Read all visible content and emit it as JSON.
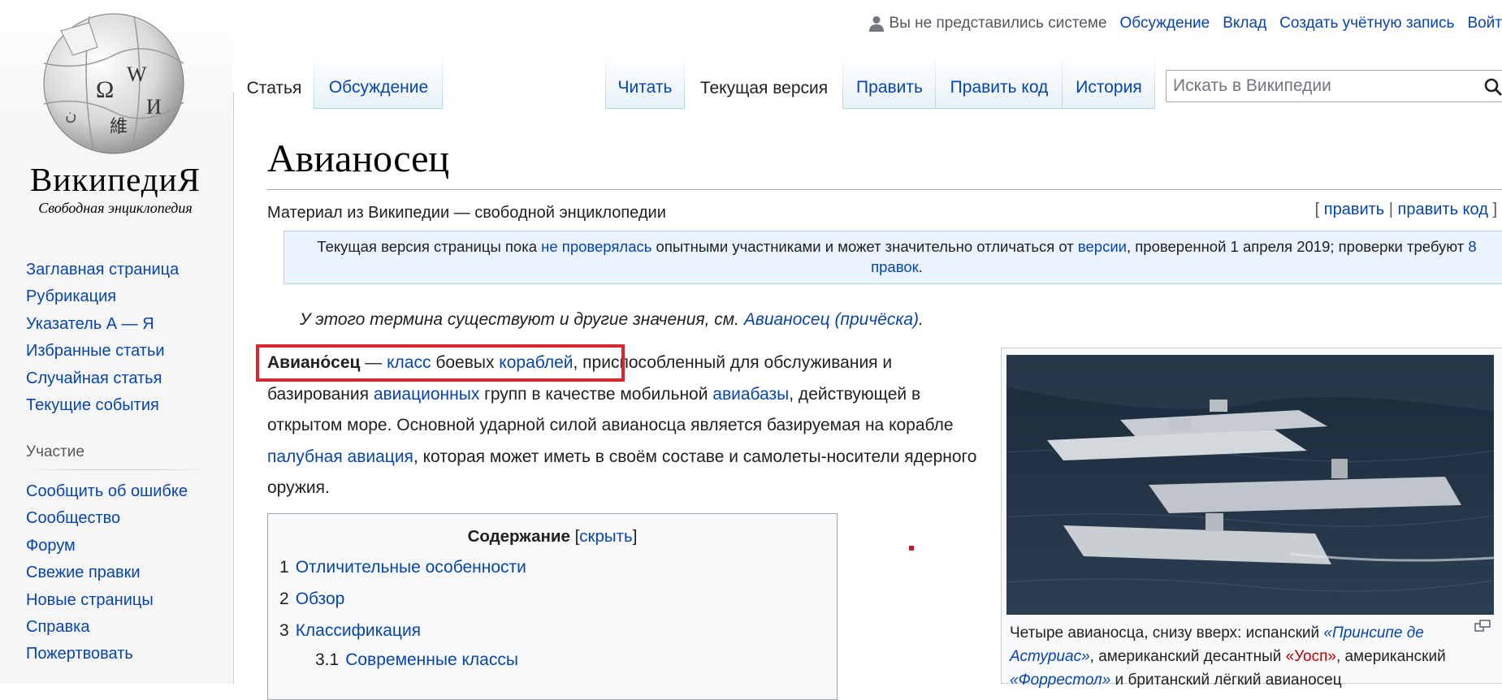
{
  "personal": {
    "anon_text": "Вы не представились системе",
    "talk": "Обсуждение",
    "contributions": "Вклад",
    "create_account": "Создать учётную запись",
    "login": "Войт"
  },
  "logo": {
    "wordmark": "ВикипедиЯ",
    "tagline": "Свободная энциклопедия"
  },
  "sidebar": {
    "navigation": [
      "Заглавная страница",
      "Рубрикация",
      "Указатель А — Я",
      "Избранные статьи",
      "Случайная статья",
      "Текущие события"
    ],
    "participation_heading": "Участие",
    "participation": [
      "Сообщить об ошибке",
      "Сообщество",
      "Форум",
      "Свежие правки",
      "Новые страницы",
      "Справка",
      "Пожертвовать"
    ]
  },
  "tabs": {
    "article": "Статья",
    "talk": "Обсуждение",
    "read": "Читать",
    "current": "Текущая версия",
    "edit": "Править",
    "edit_source": "Править код",
    "history": "История"
  },
  "search": {
    "placeholder": "Искать в Википедии"
  },
  "article": {
    "title": "Авианосец",
    "site_sub": "Материал из Википедии — свободной энциклопедии",
    "edit_links": {
      "open": "[",
      "edit": "править",
      "sep": "|",
      "edit_source": "править код",
      "close": "]"
    },
    "flagged": {
      "t1": "Текущая версия страницы пока ",
      "l1": "не проверялась",
      "t2": " опытными участниками и может значительно отличаться от ",
      "l2": "версии",
      "t3": ", проверенной 1 апреля 2019; проверки требуют ",
      "l3": "8 правок",
      "t4": "."
    },
    "hatnote": {
      "text": "У этого термина существуют и другие значения, см. ",
      "link": "Авианосец (причёска)",
      "end": "."
    },
    "lead": {
      "bold": "Авиано́сец",
      "t1": " — ",
      "l_class": "класс",
      "t2": " боевых ",
      "l_ships": "кораблей",
      "t3": ", приспособленный для обслуживания и базирования ",
      "l_aviation": "авиационных",
      "t4": " групп в качестве мобильной ",
      "l_airbase": "авиабазы",
      "t5": ", действующей в открытом море. Основной ударной силой авианосца является базируемая на корабле ",
      "l_deck": "палубная авиация",
      "t6": ", которая может иметь в своём составе и самолеты-носители ядерного оружия."
    },
    "toc": {
      "title": "Содержание",
      "bracket_open": "[",
      "hide": "скрыть",
      "bracket_close": "]",
      "items": [
        {
          "num": "1",
          "text": "Отличительные особенности"
        },
        {
          "num": "2",
          "text": "Обзор"
        },
        {
          "num": "3",
          "text": "Классификация"
        },
        {
          "num": "3.1",
          "text": "Современные классы"
        }
      ]
    },
    "thumb": {
      "c1": "Четыре авианосца, снизу вверх: испанский ",
      "l1": "«Принсипе де Астуриас»",
      "c2": ", американский десантный ",
      "l2": "«Уосп»",
      "c3": ", американский ",
      "l3": "«Форрестол»",
      "c4": " и британский лёгкий авианосец"
    }
  },
  "colors": {
    "link": "#0645ad",
    "redlink": "#ba0000",
    "highlight_box": "#d7282f",
    "tab_border": "#a7d7f9"
  }
}
